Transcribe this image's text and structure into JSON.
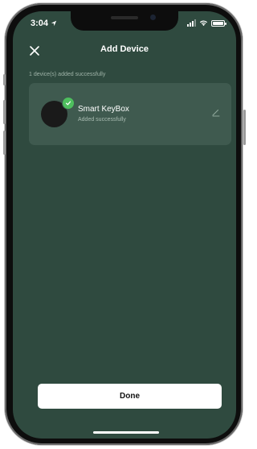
{
  "status_bar": {
    "time": "3:04",
    "icons": [
      "location-arrow-icon",
      "signal-icon",
      "wifi-icon",
      "battery-icon"
    ]
  },
  "header": {
    "title": "Add Device",
    "close_icon": "close-icon"
  },
  "summary": {
    "added_text": "1 device(s) added successfully"
  },
  "device": {
    "name": "Smart KeyBox",
    "status": "Added successfully",
    "badge_icon": "check-icon",
    "edit_icon": "pencil-icon"
  },
  "actions": {
    "done_label": "Done"
  },
  "colors": {
    "background": "#2f4a3f",
    "card": "#3f5a4f",
    "success": "#4ebf5e",
    "button": "#ffffff"
  }
}
